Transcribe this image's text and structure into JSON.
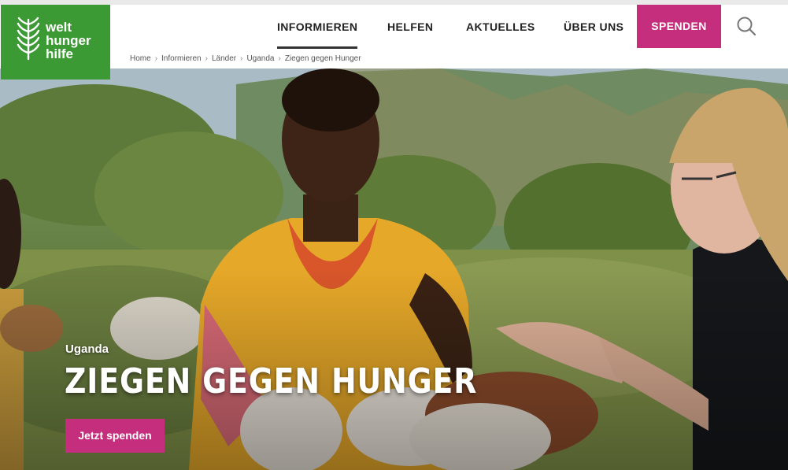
{
  "brand": {
    "logo_lines": [
      "welt",
      "hunger",
      "hilfe"
    ],
    "color": "#3c9a35"
  },
  "nav": {
    "items": [
      {
        "label": "INFORMIEREN",
        "active": true
      },
      {
        "label": "HELFEN",
        "active": false
      },
      {
        "label": "AKTUELLES",
        "active": false
      },
      {
        "label": "ÜBER UNS",
        "active": false
      }
    ],
    "donate_label": "SPENDEN",
    "donate_color": "#c42e7d",
    "search_icon": "search-icon"
  },
  "breadcrumb": {
    "items": [
      "Home",
      "Informieren",
      "Länder",
      "Uganda",
      "Ziegen gegen Hunger"
    ]
  },
  "hero": {
    "country": "Uganda",
    "title": "ZIEGEN GEGEN HUNGER",
    "cta_label": "Jetzt spenden"
  }
}
